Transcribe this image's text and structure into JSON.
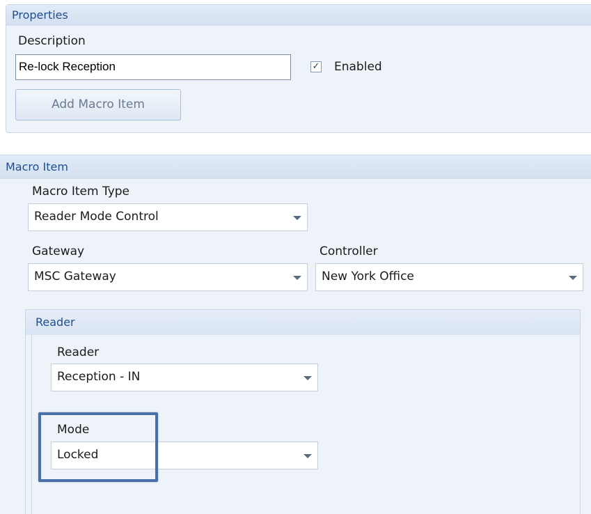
{
  "properties": {
    "header": "Properties",
    "description_label": "Description",
    "description_value": "Re-lock Reception",
    "enabled_label": "Enabled",
    "enabled_checked": true,
    "add_macro_item_label": "Add Macro Item"
  },
  "macro_item": {
    "header": "Macro Item",
    "type_label": "Macro Item Type",
    "type_value": "Reader Mode Control",
    "gateway_label": "Gateway",
    "gateway_value": "MSC Gateway",
    "controller_label": "Controller",
    "controller_value": "New York Office"
  },
  "reader": {
    "header": "Reader",
    "reader_label": "Reader",
    "reader_value": "Reception - IN",
    "mode_label": "Mode",
    "mode_value": "Locked"
  },
  "icons": {
    "checkbox": "check-icon",
    "dropdown": "chevron-down-icon"
  },
  "colors": {
    "header_text": "#1e4f8c",
    "panel_bg": "#eef3fa",
    "highlight": "#4a6fa7"
  }
}
